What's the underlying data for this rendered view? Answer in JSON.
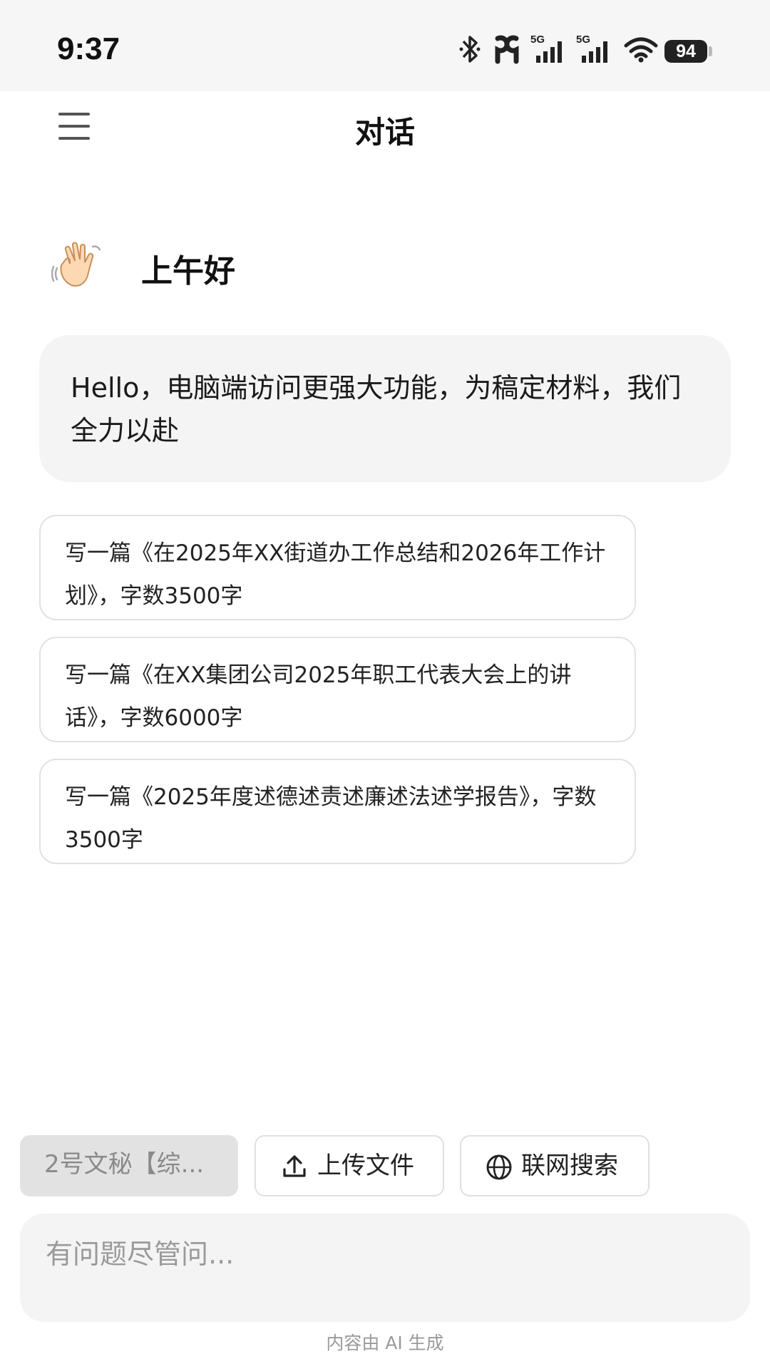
{
  "status_bar": {
    "time": "9:37",
    "battery": "94",
    "network_label_1": "5G",
    "network_label_2": "5G",
    "icons": [
      "bluetooth-icon",
      "earbuds-icon",
      "signal-5g-icon",
      "signal-5g-icon",
      "wifi-icon",
      "battery-icon"
    ]
  },
  "header": {
    "title": "对话",
    "menu_icon": "hamburger-menu-icon"
  },
  "greeting": {
    "icon": "waving-hand-icon",
    "text": "上午好"
  },
  "intro": {
    "text": "Hello，电脑端访问更强大功能，为稿定材料，我们全力以赴"
  },
  "suggestions": [
    {
      "text": "写一篇《在2025年XX街道办工作总结和2026年工作计划》，字数3500字"
    },
    {
      "text": "写一篇《在XX集团公司2025年职工代表大会上的讲话》，字数6000字"
    },
    {
      "text": "写一篇《2025年度述德述责述廉述法述学报告》，字数3500字"
    }
  ],
  "toolbar": {
    "model_label": "2号文秘【综...",
    "upload_label": "上传文件",
    "upload_icon": "upload-icon",
    "search_label": "联网搜索",
    "search_icon": "globe-icon"
  },
  "input": {
    "placeholder": "有问题尽管问..."
  },
  "footer": {
    "disclaimer": "内容由 AI 生成"
  },
  "colors": {
    "background": "#ffffff",
    "bubble": "#f4f4f4",
    "chip_selected": "#e2e2e2",
    "muted_text": "#9a9a9a"
  }
}
